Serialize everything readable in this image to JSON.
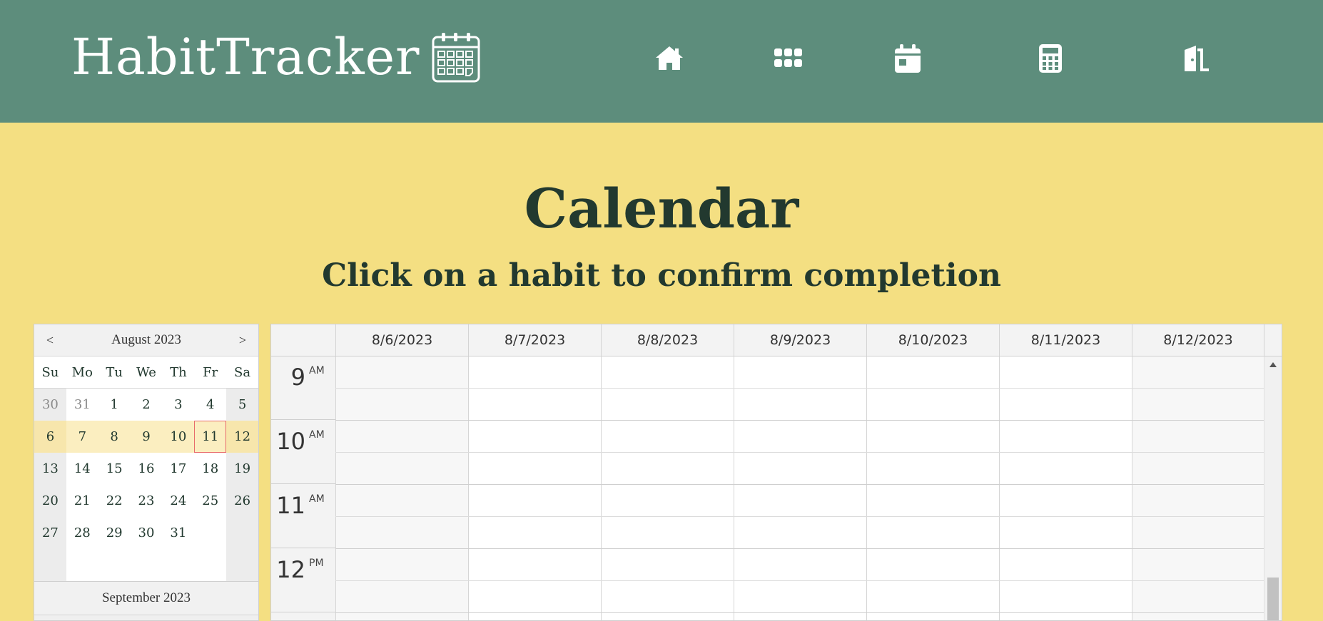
{
  "header": {
    "brand": "HabitTracker",
    "brand_icon": "calendar-logo-icon",
    "nav": [
      {
        "name": "home-icon",
        "label": "home"
      },
      {
        "name": "apps-grid-icon",
        "label": "habits"
      },
      {
        "name": "calendar-icon",
        "label": "calendar"
      },
      {
        "name": "calculator-icon",
        "label": "calculator"
      },
      {
        "name": "logout-door-icon",
        "label": "logout"
      }
    ],
    "colors": {
      "bar": "#5d8d7c",
      "text": "#ffffff"
    }
  },
  "page": {
    "title": "Calendar",
    "subtitle": "Click on a habit to confirm completion",
    "background": "#f4df82",
    "text_color": "#22392f"
  },
  "mini_calendar": {
    "prev": "<",
    "next": ">",
    "month": "August 2023",
    "next_month": "September 2023",
    "days_of_week": [
      "Su",
      "Mo",
      "Tu",
      "We",
      "Th",
      "Fr",
      "Sa"
    ],
    "weeks": [
      [
        "30",
        "31",
        "1",
        "2",
        "3",
        "4",
        "5"
      ],
      [
        "6",
        "7",
        "8",
        "9",
        "10",
        "11",
        "12"
      ],
      [
        "13",
        "14",
        "15",
        "16",
        "17",
        "18",
        "19"
      ],
      [
        "20",
        "21",
        "22",
        "23",
        "24",
        "25",
        "26"
      ],
      [
        "27",
        "28",
        "29",
        "30",
        "31",
        "",
        ""
      ]
    ],
    "selected_week": 1,
    "today": "11",
    "today_outline_color": "#e86b6b"
  },
  "scheduler": {
    "days": [
      "8/6/2023",
      "8/7/2023",
      "8/8/2023",
      "8/9/2023",
      "8/10/2023",
      "8/11/2023",
      "8/12/2023"
    ],
    "hours": [
      {
        "num": "9",
        "ampm": "AM"
      },
      {
        "num": "10",
        "ampm": "AM"
      },
      {
        "num": "11",
        "ampm": "AM"
      },
      {
        "num": "12",
        "ampm": "PM"
      }
    ]
  }
}
